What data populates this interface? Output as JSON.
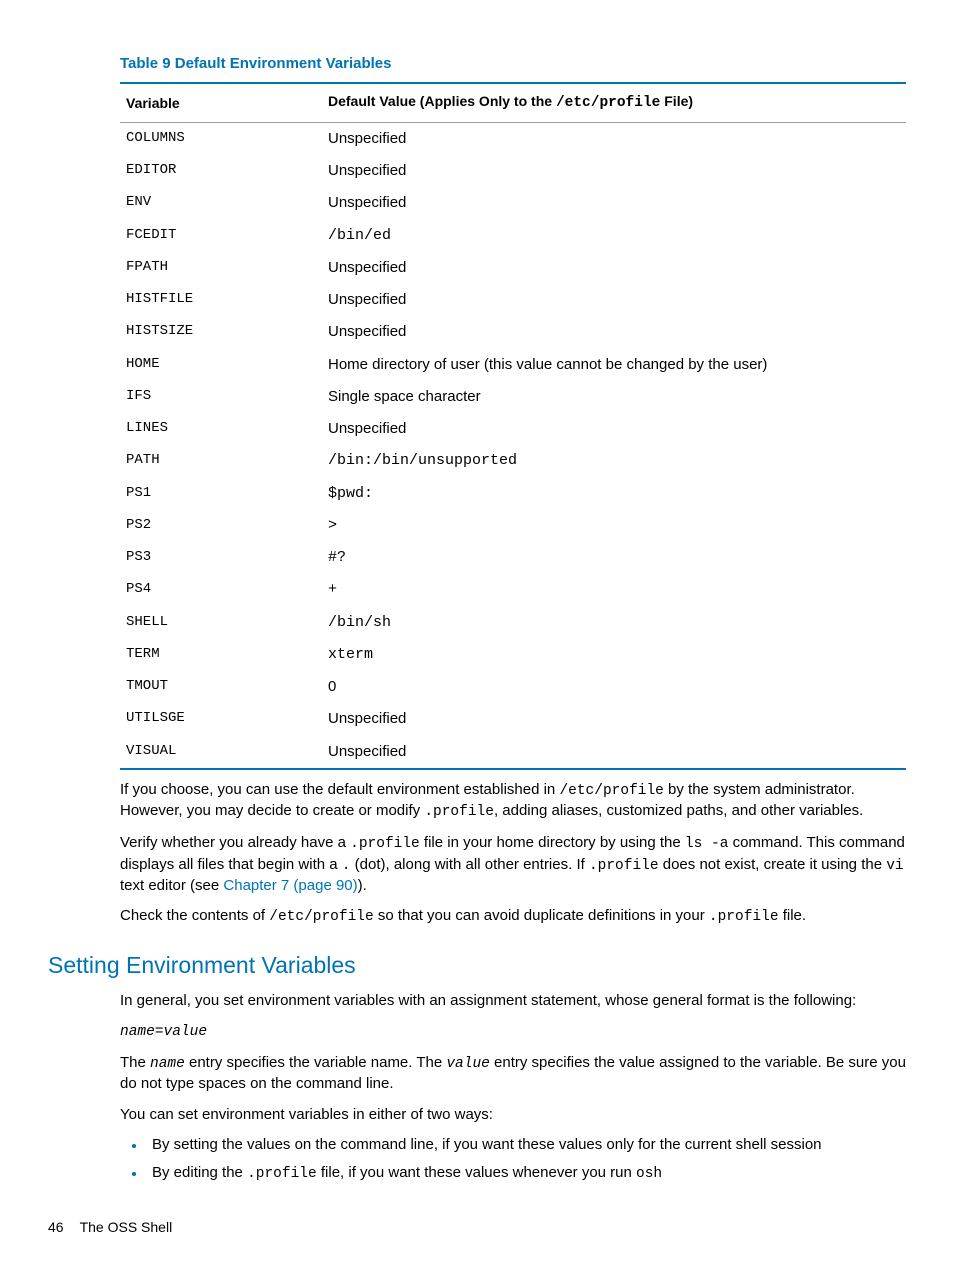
{
  "table": {
    "caption": "Table 9 Default Environment Variables",
    "header_variable": "Variable",
    "header_default_pre": "Default Value (Applies Only to the ",
    "header_default_code": "/etc/profile",
    "header_default_post": " File)",
    "rows": [
      {
        "var": "COLUMNS",
        "val": "Unspecified",
        "mono": false
      },
      {
        "var": "EDITOR",
        "val": "Unspecified",
        "mono": false
      },
      {
        "var": "ENV",
        "val": "Unspecified",
        "mono": false
      },
      {
        "var": "FCEDIT",
        "val": "/bin/ed",
        "mono": true
      },
      {
        "var": "FPATH",
        "val": "Unspecified",
        "mono": false
      },
      {
        "var": "HISTFILE",
        "val": "Unspecified",
        "mono": false
      },
      {
        "var": "HISTSIZE",
        "val": "Unspecified",
        "mono": false
      },
      {
        "var": "HOME",
        "val": "Home directory of user (this value cannot be changed by the user)",
        "mono": false
      },
      {
        "var": "IFS",
        "val": "Single space character",
        "mono": false
      },
      {
        "var": "LINES",
        "val": "Unspecified",
        "mono": false
      },
      {
        "var": "PATH",
        "val": "/bin:/bin/unsupported",
        "mono": true
      },
      {
        "var": "PS1",
        "val": "$pwd:",
        "mono": true
      },
      {
        "var": "PS2",
        "val": ">",
        "mono": true
      },
      {
        "var": "PS3",
        "val": "#?",
        "mono": true
      },
      {
        "var": "PS4",
        "val": "+",
        "mono": true
      },
      {
        "var": "SHELL",
        "val": "/bin/sh",
        "mono": true
      },
      {
        "var": "TERM",
        "val": "xterm",
        "mono": true
      },
      {
        "var": "TMOUT",
        "val": "0",
        "mono": false
      },
      {
        "var": "UTILSGE",
        "val": "Unspecified",
        "mono": false
      },
      {
        "var": "VISUAL",
        "val": "Unspecified",
        "mono": false
      }
    ]
  },
  "para1": {
    "t1": "If you choose, you can use the default environment established in ",
    "c1": "/etc/profile",
    "t2": " by the system administrator. However, you may decide to create or modify ",
    "c2": ".profile",
    "t3": ", adding aliases, customized paths, and other variables."
  },
  "para2": {
    "t1": "Verify whether you already have a ",
    "c1": ".profile",
    "t2": " file in your home directory by using the ",
    "c2": "ls -a",
    "t3": " command. This command displays all files that begin with a ",
    "c3": ".",
    "t4": " (dot), along with all other entries. If ",
    "c4": ".profile",
    "t5": " does not exist, create it using the ",
    "c5": "vi",
    "t6": " text editor (see ",
    "link": "Chapter 7 (page 90)",
    "t7": ")."
  },
  "para3": {
    "t1": "Check the contents of ",
    "c1": "/etc/profile",
    "t2": " so that you can avoid duplicate definitions in your ",
    "c2": ".profile",
    "t3": " file."
  },
  "section_heading": "Setting Environment Variables",
  "para4": "In general, you set environment variables with an assignment statement, whose general format is the following:",
  "syntax": {
    "name": "name",
    "eq": "=",
    "value": "value"
  },
  "para5": {
    "t1": "The ",
    "i1": "name",
    "t2": " entry specifies the variable name. The ",
    "i2": "value",
    "t3": " entry specifies the value assigned to the variable. Be sure you do not type spaces on the command line."
  },
  "para6": "You can set environment variables in either of two ways:",
  "bullets": [
    {
      "pre": "By setting the values on the command line, if you want these values only for the current shell session"
    },
    {
      "pre": "By editing the ",
      "code": ".profile",
      "mid": " file, if you want these values whenever you run ",
      "code2": "osh"
    }
  ],
  "footer": {
    "page": "46",
    "title": "The OSS Shell"
  }
}
